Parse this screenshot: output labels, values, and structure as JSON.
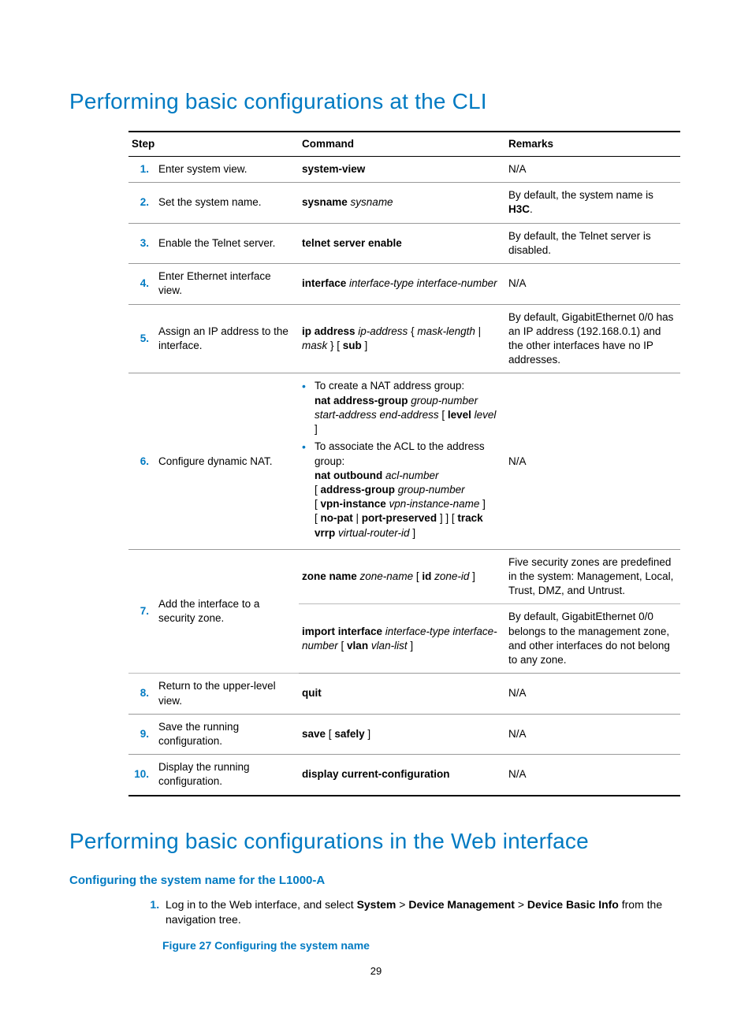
{
  "headings": {
    "h1a": "Performing basic configurations at the CLI",
    "h1b": "Performing basic configurations in the Web interface",
    "h2a": "Configuring the system name for the L1000-A",
    "fig": "Figure 27 Configuring the system name"
  },
  "table": {
    "head": {
      "c1": "Step",
      "c2": "Command",
      "c3": "Remarks"
    },
    "rows": [
      {
        "n": "1.",
        "desc": "Enter system view.",
        "cmd": [
          {
            "t": "system-view",
            "b": true
          }
        ],
        "rem": [
          {
            "t": "N/A"
          }
        ]
      },
      {
        "n": "2.",
        "desc": "Set the system name.",
        "cmd": [
          {
            "t": "sysname ",
            "b": true
          },
          {
            "t": "sysname",
            "i": true
          }
        ],
        "rem": [
          {
            "t": "By default, the system name is "
          },
          {
            "t": "H3C",
            "b": true
          },
          {
            "t": "."
          }
        ]
      },
      {
        "n": "3.",
        "desc": "Enable the Telnet server.",
        "cmd": [
          {
            "t": "telnet server enable",
            "b": true
          }
        ],
        "rem": [
          {
            "t": "By default, the Telnet server is disabled."
          }
        ]
      },
      {
        "n": "4.",
        "desc": "Enter Ethernet interface view.",
        "cmd": [
          {
            "t": "interface ",
            "b": true
          },
          {
            "t": "interface-type interface-number",
            "i": true
          }
        ],
        "rem": [
          {
            "t": "N/A"
          }
        ]
      },
      {
        "n": "5.",
        "desc": "Assign an IP address to the interface.",
        "cmd": [
          {
            "t": "ip address ",
            "b": true
          },
          {
            "t": "ip-address",
            "i": true
          },
          {
            "t": " { "
          },
          {
            "t": "mask-length",
            "i": true
          },
          {
            "t": " | "
          },
          {
            "t": "mask",
            "i": true
          },
          {
            "t": " } [ "
          },
          {
            "t": "sub",
            "b": true
          },
          {
            "t": " ]"
          }
        ],
        "rem": [
          {
            "t": "By default, GigabitEthernet 0/0 has an IP address (192.168.0.1) and the other interfaces have no IP addresses."
          }
        ]
      },
      {
        "n": "6.",
        "desc": "Configure dynamic NAT.",
        "bullets": [
          [
            {
              "t": "To create a NAT address group:"
            },
            {
              "br": true
            },
            {
              "t": "nat address-group ",
              "b": true
            },
            {
              "t": "group-number start-address end-address",
              "i": true
            },
            {
              "t": " [ "
            },
            {
              "t": "level",
              "b": true
            },
            {
              "t": " "
            },
            {
              "t": "level",
              "i": true
            },
            {
              "t": " ]"
            }
          ],
          [
            {
              "t": "To associate the ACL to the address group:"
            },
            {
              "br": true
            },
            {
              "t": "nat outbound ",
              "b": true
            },
            {
              "t": "acl-number",
              "i": true
            },
            {
              "br": true
            },
            {
              "t": "[ "
            },
            {
              "t": "address-group ",
              "b": true
            },
            {
              "t": "group-number",
              "i": true
            },
            {
              "br": true
            },
            {
              "t": "[ "
            },
            {
              "t": "vpn-instance ",
              "b": true
            },
            {
              "t": "vpn-instance-name",
              "i": true
            },
            {
              "t": " ]"
            },
            {
              "br": true
            },
            {
              "t": "[ "
            },
            {
              "t": "no-pat",
              "b": true
            },
            {
              "t": " | "
            },
            {
              "t": "port-preserved",
              "b": true
            },
            {
              "t": " ] ] [ "
            },
            {
              "t": "track vrrp ",
              "b": true
            },
            {
              "t": "virtual-router-id",
              "i": true
            },
            {
              "t": " ]"
            }
          ]
        ],
        "rem": [
          {
            "t": "N/A"
          }
        ]
      },
      {
        "n": "7.",
        "desc": "Add the interface to a security zone.",
        "subrows": [
          {
            "cmd": [
              {
                "t": "zone name ",
                "b": true
              },
              {
                "t": "zone-name",
                "i": true
              },
              {
                "t": " [ "
              },
              {
                "t": "id ",
                "b": true
              },
              {
                "t": "zone-id",
                "i": true
              },
              {
                "t": " ]"
              }
            ],
            "rem": [
              {
                "t": "Five security zones are predefined in the system: Management, Local, Trust, DMZ, and Untrust."
              }
            ]
          },
          {
            "cmd": [
              {
                "t": "import interface ",
                "b": true
              },
              {
                "t": "interface-type interface-number",
                "i": true
              },
              {
                "t": " [ "
              },
              {
                "t": "vlan ",
                "b": true
              },
              {
                "t": "vlan-list",
                "i": true
              },
              {
                "t": " ]"
              }
            ],
            "rem": [
              {
                "t": "By default, GigabitEthernet 0/0 belongs to the management zone, and other interfaces do not belong to any zone."
              }
            ]
          }
        ]
      },
      {
        "n": "8.",
        "desc": "Return to the upper-level view.",
        "cmd": [
          {
            "t": "quit",
            "b": true
          }
        ],
        "rem": [
          {
            "t": "N/A"
          }
        ]
      },
      {
        "n": "9.",
        "desc": "Save the running configuration.",
        "cmd": [
          {
            "t": "save",
            "b": true
          },
          {
            "t": " [ "
          },
          {
            "t": "safely",
            "b": true
          },
          {
            "t": " ]"
          }
        ],
        "rem": [
          {
            "t": "N/A"
          }
        ]
      },
      {
        "n": "10.",
        "desc": "Display the running configuration.",
        "cmd": [
          {
            "t": "display current-configuration",
            "b": true
          }
        ],
        "rem": [
          {
            "t": "N/A"
          }
        ]
      }
    ]
  },
  "body_list": {
    "item1": {
      "pre": "Log in to the Web interface, and select ",
      "p1": "System",
      "sep": " > ",
      "p2": "Device Management",
      "p3": "Device Basic Info",
      "post": " from the navigation tree."
    }
  },
  "page_number": "29"
}
